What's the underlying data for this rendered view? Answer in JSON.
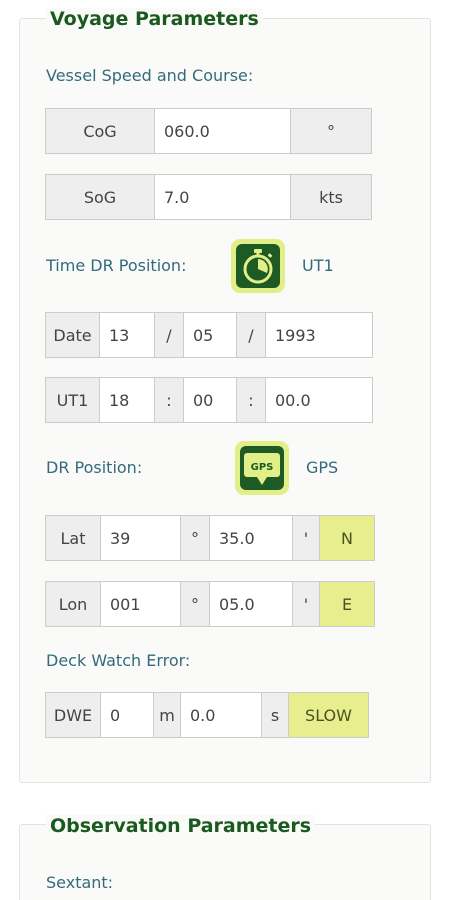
{
  "voyage": {
    "legend": "Voyage Parameters",
    "speed_course_label": "Vessel Speed and Course:",
    "cog": {
      "label": "CoG",
      "value": "060.0",
      "unit": "°"
    },
    "sog": {
      "label": "SoG",
      "value": "7.0",
      "unit": "kts"
    },
    "time_dr_label": "Time DR Position:",
    "time_source": "UT1",
    "date": {
      "label": "Date",
      "day": "13",
      "sep": "/",
      "month": "05",
      "year": "1993"
    },
    "ut1": {
      "label": "UT1",
      "hour": "18",
      "sep": ":",
      "minute": "00",
      "second": "00.0"
    },
    "dr_position_label": "DR Position:",
    "position_source": "GPS",
    "gps_icon_text": "GPS",
    "lat": {
      "label": "Lat",
      "deg": "39",
      "deg_sym": "°",
      "min": "35.0",
      "min_sym": "'",
      "hemi": "N"
    },
    "lon": {
      "label": "Lon",
      "deg": "001",
      "deg_sym": "°",
      "min": "05.0",
      "min_sym": "'",
      "hemi": "E"
    },
    "dwe_label": "Deck Watch Error:",
    "dwe": {
      "label": "DWE",
      "minutes": "0",
      "m_unit": "m",
      "seconds": "0.0",
      "s_unit": "s",
      "direction": "SLOW"
    }
  },
  "observation": {
    "legend": "Observation Parameters",
    "sextant_label": "Sextant:"
  },
  "colors": {
    "accent_green": "#1d5a24",
    "highlight_yellow": "#e2ee88",
    "label_blue": "#336b7d"
  }
}
